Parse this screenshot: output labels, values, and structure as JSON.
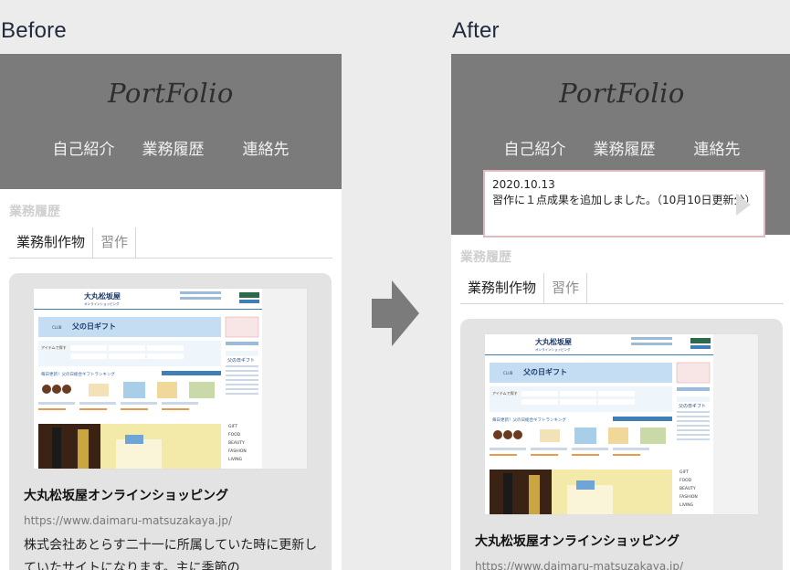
{
  "labels": {
    "before": "Before",
    "after": "After"
  },
  "site": {
    "logo": "PortFolio",
    "nav": [
      "自己紹介",
      "業務履歴",
      "連絡先"
    ],
    "section_title": "業務履歴",
    "tabs": [
      "業務制作物",
      "習作"
    ]
  },
  "card": {
    "title": "大丸松坂屋オンラインショッピング",
    "url": "https://www.daimaru-matsuzakaya.jp/",
    "description": "株式会社あとらす二十一に所属していた時に更新していたサイトになります。主に季節の"
  },
  "notice": {
    "date": "2020.10.13",
    "text": "習作に１点成果を追加しました。（10月10日更新分）"
  },
  "thumbnail": {
    "store_name": "大丸松坂屋",
    "store_sub": "オンラインショッピング",
    "banner": "父の日ギフト",
    "banner_tag": "CLUB",
    "menu_label": "アイテムで探す",
    "ranking": "毎日更新！父の日総合ギフトランキング",
    "side_heading": "父の日ギフト",
    "categories": [
      "GIFT",
      "FOOD",
      "BEAUTY",
      "FASHION",
      "LIVING"
    ]
  },
  "colors": {
    "header": "#7b7b7b",
    "card": "#e3e3e3",
    "notice_border": "#e1b9be",
    "arrow": "#7b7b7b"
  }
}
